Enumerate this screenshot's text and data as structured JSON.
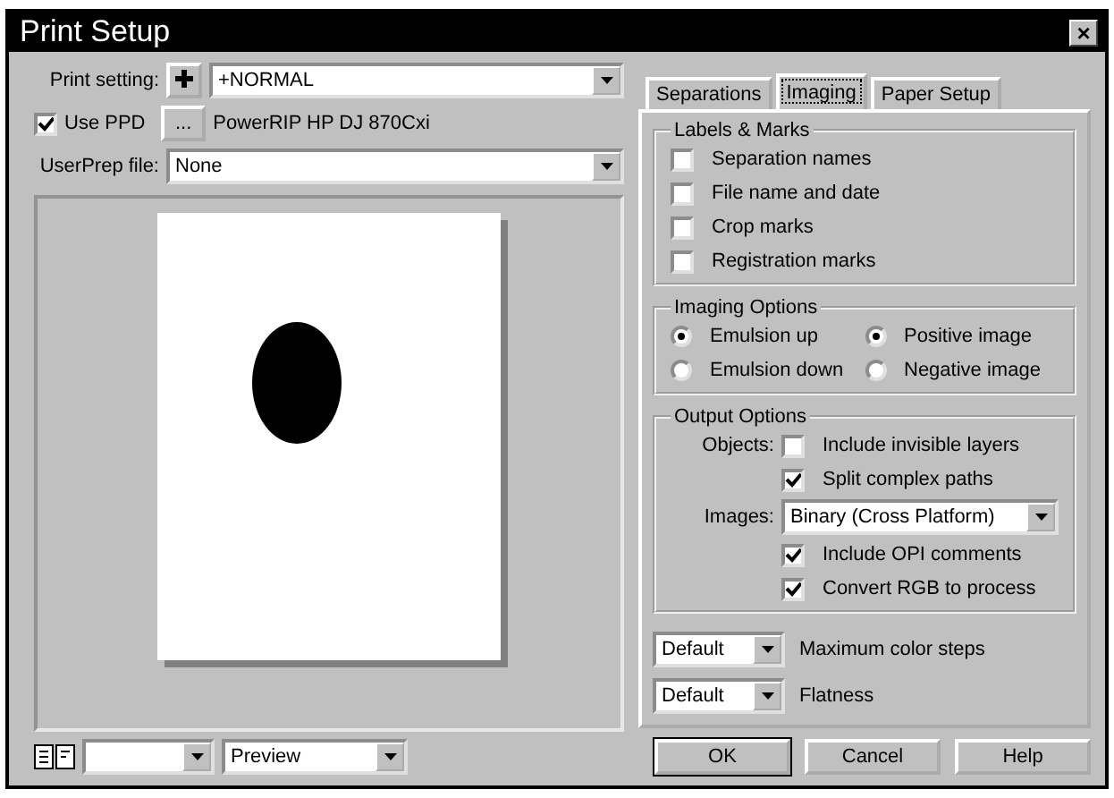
{
  "window": {
    "title": "Print Setup",
    "close": "×"
  },
  "print_setting": {
    "label": "Print setting:",
    "value": "+NORMAL"
  },
  "use_ppd": {
    "label": "Use PPD",
    "checked": true,
    "button": "...",
    "printer": "PowerRIP HP DJ 870Cxi"
  },
  "userprep": {
    "label": "UserPrep file:",
    "value": "None"
  },
  "preview_bar": {
    "view": "Preview"
  },
  "tabs": [
    {
      "label": "Separations",
      "selected": false
    },
    {
      "label": "Imaging",
      "selected": true
    },
    {
      "label": "Paper Setup",
      "selected": false
    }
  ],
  "labels_marks": {
    "title": "Labels & Marks",
    "items": [
      {
        "label": "Separation names",
        "checked": false
      },
      {
        "label": "File name and date",
        "checked": false
      },
      {
        "label": "Crop marks",
        "checked": false
      },
      {
        "label": "Registration marks",
        "checked": false
      }
    ]
  },
  "imaging_options": {
    "title": "Imaging Options",
    "emulsion": [
      {
        "label": "Emulsion up",
        "selected": true
      },
      {
        "label": "Emulsion down",
        "selected": false
      }
    ],
    "image": [
      {
        "label": "Positive image",
        "selected": true
      },
      {
        "label": "Negative image",
        "selected": false
      }
    ]
  },
  "output_options": {
    "title": "Output Options",
    "objects_label": "Objects:",
    "objects": [
      {
        "label": "Include invisible layers",
        "checked": false
      },
      {
        "label": "Split complex paths",
        "checked": true
      }
    ],
    "images_label": "Images:",
    "images_value": "Binary (Cross Platform)",
    "images": [
      {
        "label": "Include OPI comments",
        "checked": true
      },
      {
        "label": "Convert RGB to process",
        "checked": true
      }
    ]
  },
  "selects": [
    {
      "value": "Default",
      "label": "Maximum color steps"
    },
    {
      "value": "Default",
      "label": "Flatness"
    }
  ],
  "buttons": [
    "OK",
    "Cancel",
    "Help"
  ]
}
